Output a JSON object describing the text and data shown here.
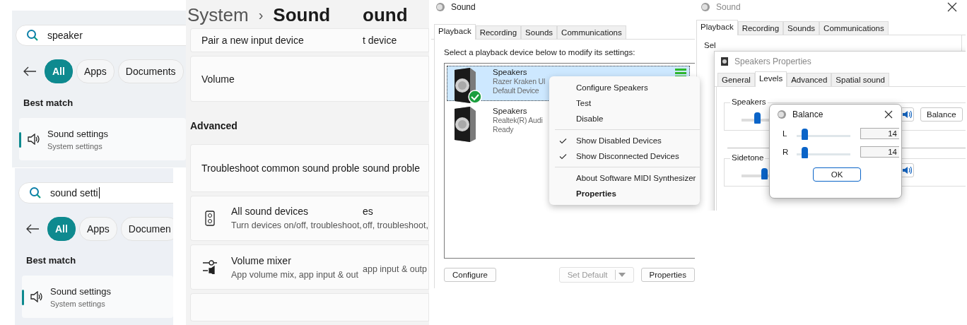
{
  "search_panels": [
    {
      "query": "speaker",
      "caret": false,
      "filters": [
        {
          "label": "All",
          "selected": true
        },
        {
          "label": "Apps",
          "selected": false
        },
        {
          "label": "Documents",
          "selected": false
        }
      ],
      "section": "Best match",
      "result": {
        "title": "Sound settings",
        "subtitle": "System settings",
        "selected": true
      }
    },
    {
      "query": "sound setti",
      "caret": true,
      "filters": [
        {
          "label": "All",
          "selected": true
        },
        {
          "label": "Apps",
          "selected": false
        },
        {
          "label": "Documen",
          "selected": false
        }
      ],
      "section": "Best match",
      "result": {
        "title": "Sound settings",
        "subtitle": "System settings",
        "selected": true
      }
    }
  ],
  "settings_columns": [
    {
      "header": {
        "parent": "System",
        "separator": "›",
        "current": "Sound"
      },
      "rows": [
        {
          "kind": "card",
          "title": "Pair a new input device"
        },
        {
          "kind": "card",
          "title": "Volume"
        },
        {
          "kind": "heading",
          "title": "Advanced"
        },
        {
          "kind": "card",
          "title": "Troubleshoot common sound proble"
        },
        {
          "kind": "speaker_card",
          "title": "All sound devices",
          "subtitle": "Turn devices on/off, troubleshoot,"
        },
        {
          "kind": "mixer_card",
          "title": "Volume mixer",
          "subtitle": "App volume mix, app input & out"
        },
        {
          "kind": "card"
        }
      ]
    },
    {
      "header": {
        "current": "ound"
      },
      "rows": [
        {
          "kind": "card",
          "title": "t device"
        },
        {
          "kind": "card"
        },
        {
          "kind": "heading"
        },
        {
          "kind": "card",
          "title": "sound proble"
        },
        {
          "kind": "card",
          "title": "es",
          "subtitle": "off, troubleshoot,"
        },
        {
          "kind": "card",
          "subtitle": "app input & outp"
        },
        {
          "kind": "card"
        }
      ]
    }
  ],
  "sound_dialog": {
    "title": "Sound",
    "tabs": [
      {
        "label": "Playback",
        "selected": true
      },
      {
        "label": "Recording",
        "selected": false
      },
      {
        "label": "Sounds",
        "selected": false
      },
      {
        "label": "Communications",
        "selected": false
      }
    ],
    "instruction": "Select a playback device below to modify its settings:",
    "devices": [
      {
        "name": "Speakers",
        "description": "Razer Kraken Ul",
        "status": "Default Device",
        "selected": true,
        "default": true,
        "meter": true
      },
      {
        "name": "Speakers",
        "description": "Realtek(R) Audi",
        "status": "Ready",
        "selected": false,
        "default": false
      }
    ],
    "context_menu": [
      {
        "kind": "item",
        "label": "Configure Speakers"
      },
      {
        "kind": "item",
        "label": "Test"
      },
      {
        "kind": "item",
        "label": "Disable"
      },
      {
        "kind": "separator"
      },
      {
        "kind": "check",
        "label": "Show Disabled Devices",
        "checked": true
      },
      {
        "kind": "check",
        "label": "Show Disconnected Devices",
        "checked": true
      },
      {
        "kind": "separator"
      },
      {
        "kind": "item",
        "label": "About Software MIDI Synthesizer"
      },
      {
        "kind": "default",
        "label": "Properties"
      }
    ],
    "buttons": [
      {
        "label": "Configure",
        "disabled": false,
        "dropdown": false
      },
      {
        "label": "Set Default",
        "disabled": true,
        "dropdown": true
      },
      {
        "label": "Properties",
        "disabled": false,
        "dropdown": false
      }
    ]
  },
  "properties_stack": {
    "back_window": {
      "title": "Sound",
      "tabs": [
        {
          "label": "Playback",
          "selected": true
        },
        {
          "label": "Recording",
          "selected": false
        },
        {
          "label": "Sounds",
          "selected": false
        },
        {
          "label": "Communications",
          "selected": false
        }
      ],
      "instruction": "Sel"
    },
    "properties": {
      "title": "Speakers Properties",
      "tabs": [
        {
          "label": "General",
          "selected": false
        },
        {
          "label": "Levels",
          "selected": true
        },
        {
          "label": "Advanced",
          "selected": false
        },
        {
          "label": "Spatial sound",
          "selected": false
        }
      ],
      "groups": [
        {
          "label": "Speakers",
          "level": 0.14,
          "button": "Balance"
        },
        {
          "label": "Sidetone",
          "level": 0.2
        }
      ]
    },
    "balance": {
      "title": "Balance",
      "channels": [
        {
          "label": "L",
          "level": 0.14,
          "value": "14"
        },
        {
          "label": "R",
          "level": 0.14,
          "value": "14"
        }
      ],
      "ok": "OK"
    }
  }
}
